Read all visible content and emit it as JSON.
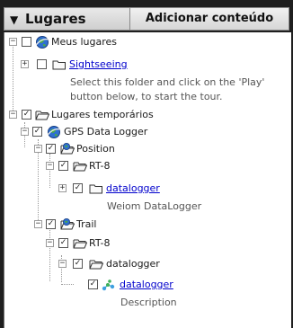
{
  "header": {
    "title": "Lugares",
    "add_content_button": "Adicionar conteúdo"
  },
  "tree": {
    "my_places": {
      "label": "Meus lugares",
      "checked": false,
      "sightseeing": {
        "label": "Sightseeing",
        "checked": false,
        "description_line1": "Select this folder and click on the 'Play'",
        "description_line2": "button below, to start the tour."
      }
    },
    "temp_places": {
      "label": "Lugares temporários",
      "checked": true,
      "gps_logger": {
        "label": "GPS Data Logger",
        "checked": true,
        "position": {
          "label": "Position",
          "checked": true,
          "rt8": {
            "label": "RT-8",
            "checked": true,
            "datalogger": {
              "label": "datalogger",
              "checked": true,
              "description": "Weiom DataLogger"
            }
          }
        },
        "trail": {
          "label": "Trail",
          "checked": true,
          "rt8": {
            "label": "RT-8",
            "checked": true,
            "datalogger_folder": {
              "label": "datalogger",
              "checked": true,
              "datalogger_item": {
                "label": "datalogger",
                "checked": true,
                "description": "Description"
              }
            }
          }
        }
      }
    }
  },
  "colors": {
    "background": "#1f1f1f",
    "tree_background": "#ffffff",
    "link": "#0000cc",
    "description": "#555555"
  }
}
